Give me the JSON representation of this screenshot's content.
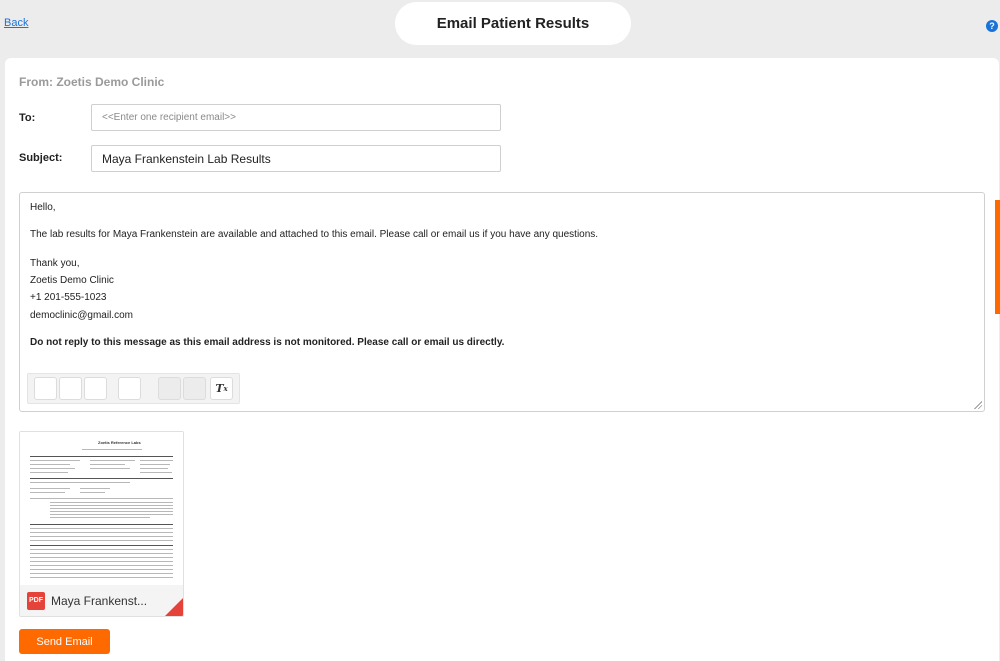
{
  "header": {
    "back_label": "Back",
    "title": "Email Patient Results",
    "help_glyph": "?"
  },
  "form": {
    "from_text": "From: Zoetis Demo Clinic",
    "to_label": "To:",
    "to_placeholder": "<<Enter one recipient email>>",
    "subject_label": "Subject:",
    "subject_value": "Maya Frankenstein Lab Results"
  },
  "body": {
    "greeting": "Hello,",
    "message": "The lab results for Maya Frankenstein are available and attached to this email. Please call or email us if you have any questions.",
    "signoff": "Thank you,",
    "clinic": "Zoetis Demo Clinic",
    "phone": "+1 201-555-1023",
    "email": "democlinic@gmail.com",
    "notice": "Do not reply to this message as this email address is not monitored. Please call or email us directly."
  },
  "toolbar": {
    "clear_format_glyph": "Tx",
    "clear_format_icon": "clear-formatting-icon"
  },
  "attachment": {
    "badge": "PDF",
    "name": "Maya Frankenst...",
    "thumb_title": "Zoetis Reference Labs",
    "icon": "pdf-icon"
  },
  "actions": {
    "send_label": "Send Email"
  },
  "colors": {
    "accent": "#ff6a00",
    "link": "#1a73d9",
    "pdf": "#e5423a"
  }
}
